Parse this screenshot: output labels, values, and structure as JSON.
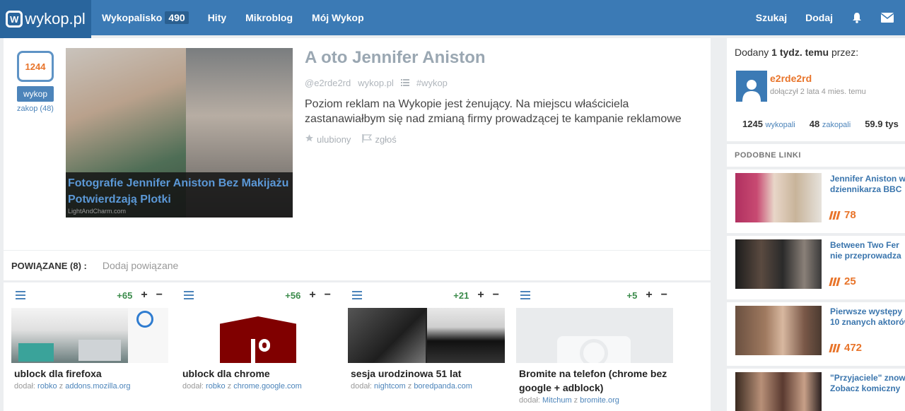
{
  "nav": {
    "logo": "wykop.pl",
    "items": [
      {
        "label": "Wykopalisko",
        "badge": "490"
      },
      {
        "label": "Hity"
      },
      {
        "label": "Mikroblog"
      },
      {
        "label": "Mój Wykop"
      }
    ],
    "search": "Szukaj",
    "add": "Dodaj",
    "icons": [
      "bell-icon",
      "envelope-icon"
    ]
  },
  "vote": {
    "count": "1244",
    "button": "wykop",
    "bury": "zakop (48)"
  },
  "thumbnail": {
    "caption": "Fotografie Jennifer Aniston Bez Makijażu Potwierdzają Plotki",
    "source": "LightAndCharm.com"
  },
  "article": {
    "title": "A oto Jennifer Aniston",
    "author": "@e2rde2rd",
    "domain": "wykop.pl",
    "tag": "#wykop",
    "description": "Poziom reklam na Wykopie jest żenujący. Na miejscu właściciela zastanawiałbym się nad zmianą firmy prowadzącej te kampanie reklamowe",
    "favorite": "ulubiony",
    "report": "zgłoś"
  },
  "related": {
    "title": "POWIĄZANE (8) :",
    "add": "Dodaj powiązane",
    "cards": [
      {
        "score": "+65",
        "title": "ublock dla firefoxa",
        "by_prefix": "dodał:",
        "user": "robko",
        "z": "z",
        "domain": "addons.mozilla.org"
      },
      {
        "score": "+56",
        "title": "ublock dla chrome",
        "by_prefix": "dodał:",
        "user": "robko",
        "z": "z",
        "domain": "chrome.google.com"
      },
      {
        "score": "+21",
        "title": "sesja urodzinowa 51 lat",
        "by_prefix": "dodał:",
        "user": "nightcom",
        "z": "z",
        "domain": "boredpanda.com"
      },
      {
        "score": "+5",
        "title": "Bromite na telefon (chrome bez google + adblock)",
        "by_prefix": "dodał:",
        "user": "Mitchum",
        "z": "z",
        "domain": "bromite.org"
      }
    ],
    "plus": "+",
    "minus": "−"
  },
  "sidebar": {
    "added_prefix": "Dodany",
    "added_time": "1 tydz. temu",
    "added_suffix": "przez:",
    "user": "e2rde2rd",
    "joined": "dołączył 2 lata 4 mies. temu",
    "stats": [
      {
        "value": "1245",
        "label": "wykopali"
      },
      {
        "value": "48",
        "label": "zakopali"
      },
      {
        "value": "59.9 tys",
        "label": ""
      }
    ],
    "similar_title": "PODOBNE LINKI",
    "similar": [
      {
        "title_line1": "Jennifer Aniston w",
        "title_line2": "dziennikarza BBC",
        "count": "78"
      },
      {
        "title_line1": "Between Two Fer",
        "title_line2": "nie przeprowadza",
        "count": "25"
      },
      {
        "title_line1": "Pierwsze występy",
        "title_line2": "10 znanych aktorów",
        "count": "472"
      },
      {
        "title_line1": "\"Przyjaciele\" znow",
        "title_line2": "Zobacz komiczny",
        "count": ""
      }
    ]
  },
  "colors": {
    "brand": "#3b7ab5",
    "accent": "#e8742a",
    "positive": "#3b8b4b"
  }
}
